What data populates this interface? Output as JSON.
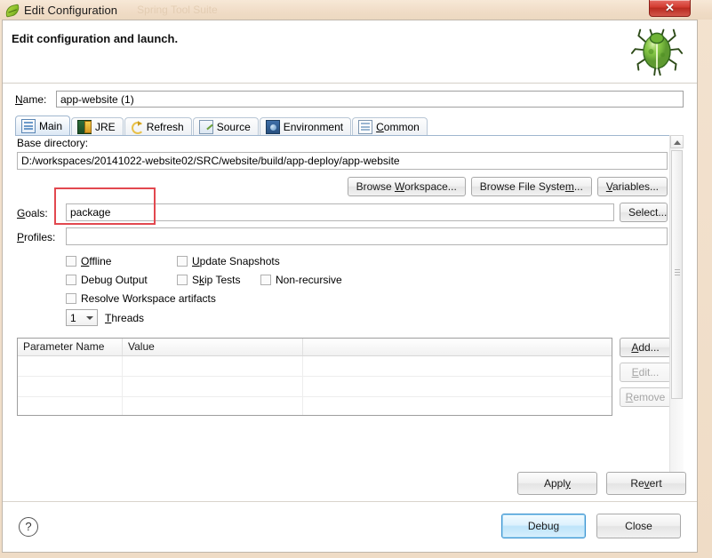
{
  "window": {
    "title": "Edit Configuration",
    "ghost_title": "Spring Tool Suite",
    "icon": "leaf-icon",
    "close_label": "✕"
  },
  "header": {
    "title": "Edit configuration and launch.",
    "icon": "bug-icon"
  },
  "name_field": {
    "label": "Name:",
    "value": "app-website (1)"
  },
  "tabs": [
    {
      "label": "Main",
      "icon": "main-tab-icon",
      "active": true
    },
    {
      "label": "JRE",
      "icon": "jre-tab-icon",
      "active": false
    },
    {
      "label": "Refresh",
      "icon": "refresh-tab-icon",
      "active": false
    },
    {
      "label": "Source",
      "icon": "source-tab-icon",
      "active": false
    },
    {
      "label": "Environment",
      "icon": "environment-tab-icon",
      "active": false
    },
    {
      "label": "Common",
      "icon": "common-tab-icon",
      "active": false
    }
  ],
  "main_tab": {
    "base_directory": {
      "label": "Base directory:",
      "value": "D:/workspaces/20141022-website02/SRC/website/build/app-deploy/app-website",
      "buttons": {
        "browse_workspace": "Browse Workspace...",
        "browse_file_system": "Browse File System...",
        "variables": "Variables..."
      }
    },
    "goals": {
      "label": "Goals:",
      "value": "package",
      "select_button": "Select...",
      "highlighted": true,
      "highlight_color": "#e2484f"
    },
    "profiles": {
      "label": "Profiles:",
      "value": ""
    },
    "options": [
      {
        "label": "Offline",
        "checked": false
      },
      {
        "label": "Update Snapshots",
        "checked": false
      },
      {
        "label": "Debug Output",
        "checked": false
      },
      {
        "label": "Skip Tests",
        "checked": false
      },
      {
        "label": "Non-recursive",
        "checked": false
      },
      {
        "label": "Resolve Workspace artifacts",
        "checked": false
      }
    ],
    "threads": {
      "value": "1",
      "label": "Threads"
    },
    "parameter_table": {
      "columns": [
        "Parameter Name",
        "Value",
        ""
      ],
      "rows": [],
      "empty_row_count": 3,
      "buttons": {
        "add": "Add...",
        "edit": "Edit...",
        "remove": "Remove"
      },
      "add_enabled": true,
      "edit_enabled": false,
      "remove_enabled": false
    }
  },
  "footer": {
    "apply": "Apply",
    "revert": "Revert",
    "help_icon": "?",
    "debug": "Debug",
    "close": "Close",
    "default_button": "Debug"
  }
}
